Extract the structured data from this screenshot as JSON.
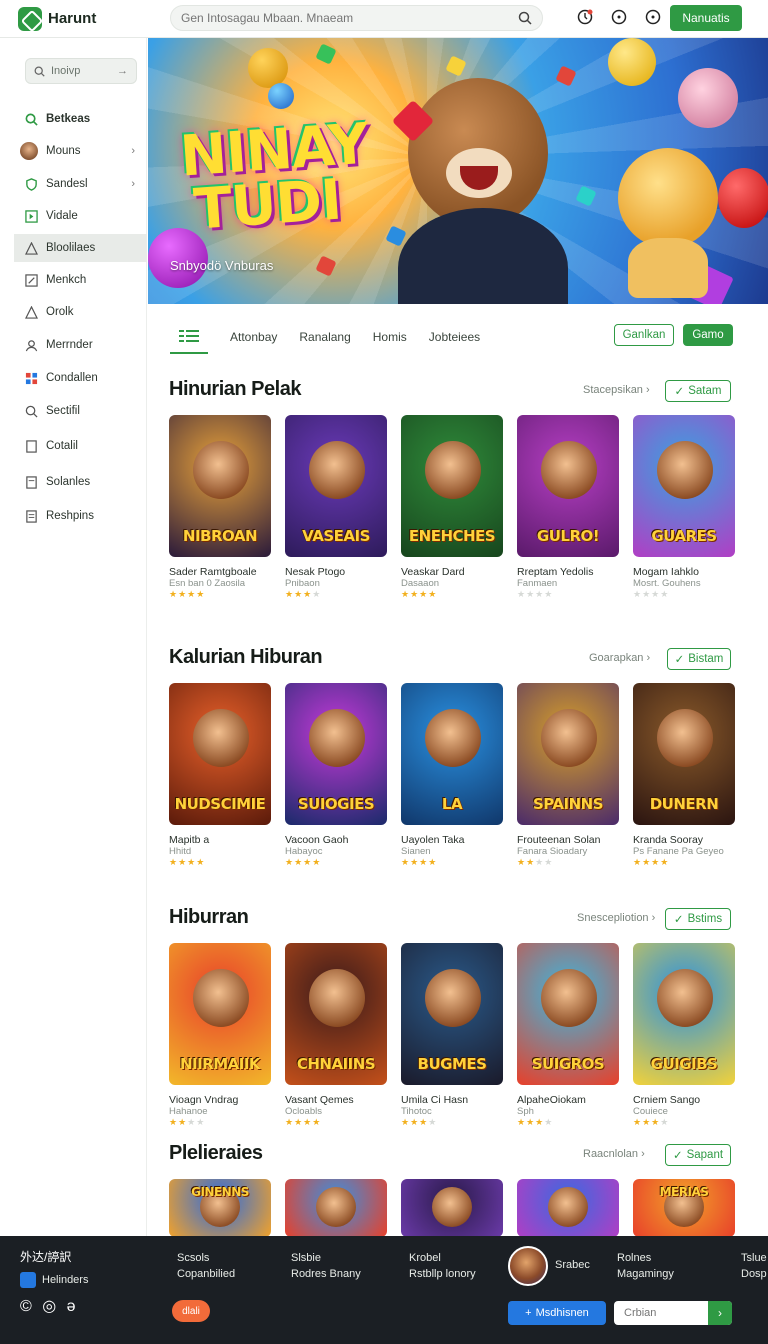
{
  "app": {
    "name": "Harunt"
  },
  "top": {
    "search_placeholder": "Gen Intosagau Mbaan. Mnaeam",
    "cta": "Nanuatis"
  },
  "sidebar": {
    "search_placeholder": "Inoivp",
    "items": [
      {
        "label": "Betkeas",
        "icon": "search-icon"
      },
      {
        "label": "Mouns",
        "icon": "avatar-icon"
      },
      {
        "label": "Sandesl",
        "icon": "shield-icon"
      },
      {
        "label": "Vidale",
        "icon": "play-icon"
      },
      {
        "label": "Bloolilaes",
        "icon": "triangle-icon"
      },
      {
        "label": "Menkch",
        "icon": "edit-icon"
      },
      {
        "label": "Orolk",
        "icon": "triangle-icon"
      },
      {
        "label": "Merrnder",
        "icon": "user-icon"
      },
      {
        "label": "Condallen",
        "icon": "grid-icon"
      },
      {
        "label": "Sectifil",
        "icon": "search-icon"
      },
      {
        "label": "Cotalil",
        "icon": "doc-icon"
      },
      {
        "label": "Solanles",
        "icon": "doc-icon"
      },
      {
        "label": "Reshpins",
        "icon": "doc-icon"
      }
    ]
  },
  "hero": {
    "title_line1": "NINAY",
    "title_line2": "TUDI",
    "subtitle": "Snbyodö Vnburas"
  },
  "tabs": {
    "items": [
      "Attonbay",
      "Ranalang",
      "Homis",
      "Jobteiees"
    ],
    "outline_button": "Ganlkan",
    "solid_button": "Gamo"
  },
  "sections": [
    {
      "title": "Hinurian Pelak",
      "more": "Stacepsikan",
      "button": "Satam",
      "cards": [
        {
          "word": "NIBROAN",
          "title": "Sader Ramtgboale",
          "sub": "Esn ban 0 Zaosila",
          "rating": 4
        },
        {
          "word": "VASEAIS",
          "title": "Nesak Ptogo",
          "sub": "Pnibaon",
          "rating": 3
        },
        {
          "word": "ENEHCHES",
          "title": "Veaskar Dard",
          "sub": "Dasaaon",
          "rating": 4
        },
        {
          "word": "GULRO!",
          "title": "Rreptam Yedolis",
          "sub": "Fanmaen",
          "rating": 0
        },
        {
          "word": "GUARES",
          "title": "Mogam Iahklo",
          "sub": "Mosrt. Gouhens",
          "rating": 0
        }
      ]
    },
    {
      "title": "Kalurian Hiburan",
      "more": "Goarapkan",
      "button": "Bistam",
      "cards": [
        {
          "word": "NUDSCIMIE",
          "title": "Mapitb a",
          "sub": "Hhitd",
          "rating": 4
        },
        {
          "word": "SUIOGIES",
          "title": "Vacoon Gaoh",
          "sub": "Habayoc",
          "rating": 4
        },
        {
          "word": "LA",
          "title": "Uayolen Taka",
          "sub": "Sianen",
          "rating": 4
        },
        {
          "word": "SPAINNS",
          "title": "Frouteenan Solan",
          "sub": "Fanara Sioadary",
          "rating": 2
        },
        {
          "word": "DUNERN",
          "title": "Kranda Sooray",
          "sub": "Ps Fanane Pa Geyeo",
          "rating": 4
        }
      ]
    },
    {
      "title": "Hiburran",
      "more": "Snescepliotion",
      "button": "Bstims",
      "cards": [
        {
          "word": "NIIRMAIIK",
          "title": "Vioagn Vndrag",
          "sub": "Hahanoe",
          "rating": 2
        },
        {
          "word": "CHNAIINS",
          "title": "Vasant Qemes",
          "sub": "Ocloabls",
          "rating": 4
        },
        {
          "word": "BUGMES",
          "title": "Umila Ci Hasn",
          "sub": "Tihotoc",
          "rating": 3
        },
        {
          "word": "SUIGROS",
          "title": "AlpaheOiokam",
          "sub": "Sph",
          "rating": 3
        },
        {
          "word": "GUIGIBS",
          "title": "Crniem Sango",
          "sub": "Couiece",
          "rating": 3
        }
      ]
    },
    {
      "title": "Plelieraies",
      "more": "Raacnlolan",
      "button": "Sapant",
      "cards": [
        {
          "word": "GINENNS",
          "title": "",
          "sub": "",
          "rating": 0
        },
        {
          "word": "",
          "title": "",
          "sub": "",
          "rating": 0
        },
        {
          "word": "",
          "title": "",
          "sub": "",
          "rating": 0
        },
        {
          "word": "",
          "title": "",
          "sub": "",
          "rating": 0
        },
        {
          "word": "MERIAS",
          "title": "",
          "sub": "",
          "rating": 0
        }
      ]
    }
  ],
  "footer": {
    "brand": "外达/諪訳",
    "helinders": "Helinders",
    "social": "© ◎ ə",
    "col1": [
      "Scsols",
      "Copanbilied"
    ],
    "col2": [
      "Slsbie",
      "Rodres Bnany"
    ],
    "col3": [
      "Krobel",
      "Rstbllp lonory"
    ],
    "avatar_label": "Srabec",
    "col5": [
      "Rolnes",
      "Magamingy"
    ],
    "col6": [
      "Tslue",
      "Dosp"
    ],
    "orange_pill": "dlali",
    "blue_button": "Msdhisnen",
    "input_placeholder": "Crbian"
  }
}
